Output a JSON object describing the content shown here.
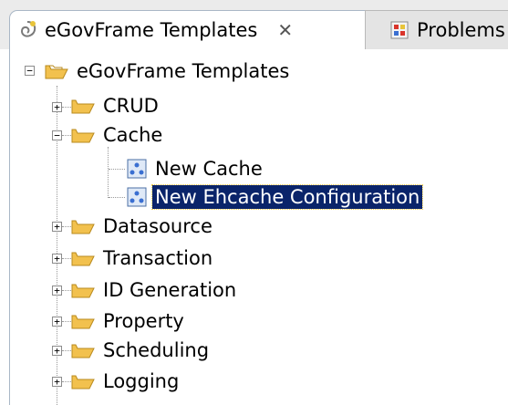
{
  "tabs": [
    {
      "label": "eGovFrame Templates",
      "close_glyph": "✕",
      "icon": "template-swirl-icon",
      "active": true
    },
    {
      "label": "Problems",
      "icon": "problems-icon",
      "active": false
    }
  ],
  "tree": {
    "root": {
      "label": "eGovFrame Templates",
      "expanded": true
    },
    "items": [
      {
        "label": "CRUD",
        "type": "folder",
        "expanded": false
      },
      {
        "label": "Cache",
        "type": "folder",
        "expanded": true,
        "children": [
          {
            "label": "New Cache",
            "type": "template"
          },
          {
            "label": "New Ehcache Configuration",
            "type": "template",
            "selected": true
          }
        ]
      },
      {
        "label": "Datasource",
        "type": "folder",
        "expanded": false
      },
      {
        "label": "Transaction",
        "type": "folder",
        "expanded": false
      },
      {
        "label": "ID Generation",
        "type": "folder",
        "expanded": false
      },
      {
        "label": "Property",
        "type": "folder",
        "expanded": false
      },
      {
        "label": "Scheduling",
        "type": "folder",
        "expanded": false
      },
      {
        "label": "Logging",
        "type": "folder",
        "expanded": false
      }
    ]
  },
  "colors": {
    "selection": "#0a246a",
    "folder": "#f2c14e",
    "tab_border": "#a9b7c6"
  }
}
